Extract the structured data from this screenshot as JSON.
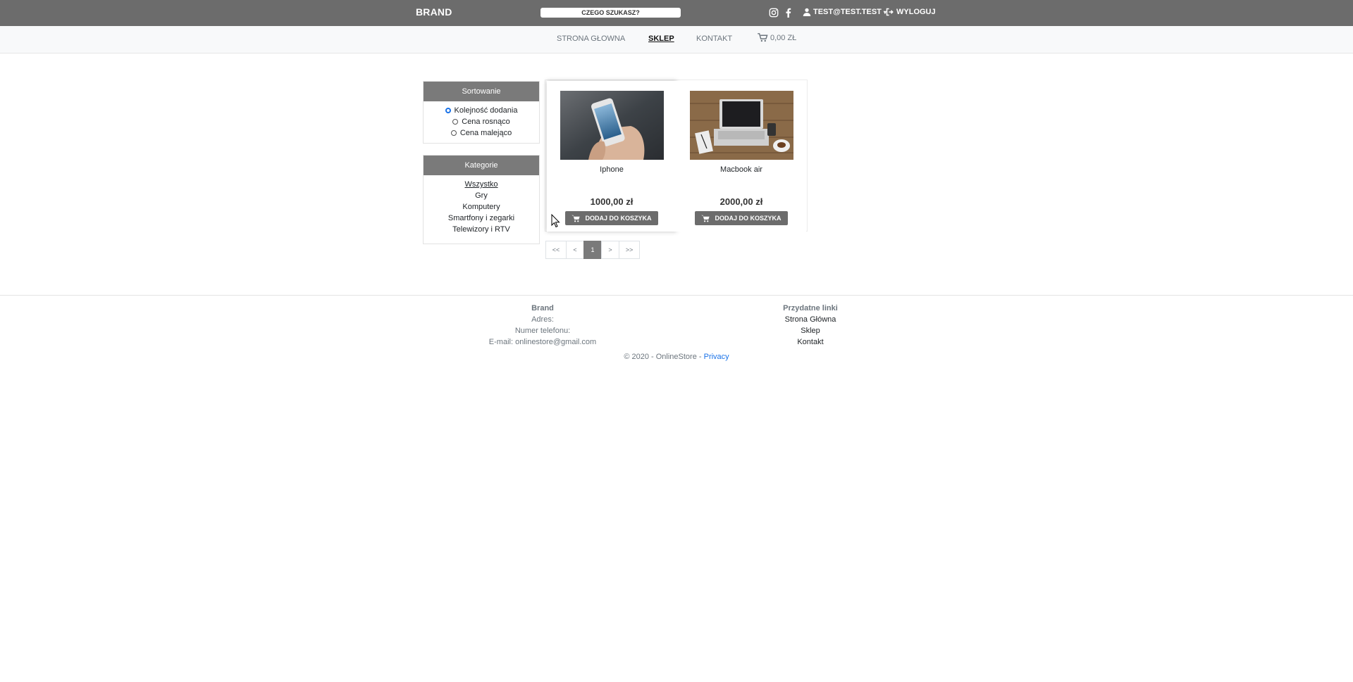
{
  "header": {
    "brand": "BRAND",
    "search_placeholder": "CZEGO SZUKASZ?",
    "user_label": "TEST@TEST.TEST",
    "logout_label": "WYLOGUJ"
  },
  "nav": {
    "items": [
      {
        "label": "STRONA GŁOWNA"
      },
      {
        "label": "SKLEP"
      },
      {
        "label": "KONTAKT"
      }
    ],
    "cart_label": "0,00 ZŁ"
  },
  "sorting": {
    "title": "Sortowanie",
    "options": [
      "Kolejność dodania",
      "Cena rosnąco",
      "Cena malejąco"
    ],
    "selected": "Kolejność dodania"
  },
  "categories": {
    "title": "Kategorie",
    "items": [
      "Wszystko",
      "Gry",
      "Komputery",
      "Smartfony i zegarki",
      "Telewizory i RTV"
    ],
    "active": "Wszystko"
  },
  "products": [
    {
      "name": "Iphone",
      "price": "1000,00 zł",
      "button": "DODAJ DO KOSZYKA"
    },
    {
      "name": "Macbook air",
      "price": "2000,00 zł",
      "button": "DODAJ DO KOSZYKA"
    }
  ],
  "pagination": {
    "first": "<<",
    "prev": "<",
    "current": "1",
    "next": ">",
    "last": ">>"
  },
  "footer": {
    "col1": {
      "title": "Brand",
      "address": "Adres:",
      "phone": "Numer telefonu:",
      "email": "E-mail: onlinestore@gmail.com"
    },
    "col2": {
      "title": "Przydatne linki",
      "links": [
        "Strona Główna",
        "Sklep",
        "Kontakt"
      ]
    },
    "copyright": "© 2020 - OnlineStore - ",
    "privacy": "Privacy"
  },
  "colors": {
    "topbar": "#6c6c6c",
    "accent": "#1a73e8"
  }
}
